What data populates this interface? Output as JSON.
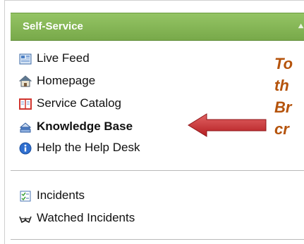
{
  "panel": {
    "title": "Self-Service",
    "collapse_icon": "double-chevron-up-icon",
    "header_color": "#84b556"
  },
  "nav": {
    "group1": [
      {
        "label": "Live Feed",
        "icon": "live-feed-icon"
      },
      {
        "label": "Homepage",
        "icon": "home-icon"
      },
      {
        "label": "Service Catalog",
        "icon": "catalog-book-icon"
      },
      {
        "label": "Knowledge Base",
        "icon": "knowledge-base-icon",
        "active": true
      },
      {
        "label": "Help the Help Desk",
        "icon": "info-icon"
      }
    ],
    "group2": [
      {
        "label": "Incidents",
        "icon": "incidents-checklist-icon"
      },
      {
        "label": "Watched Incidents",
        "icon": "glasses-icon"
      }
    ]
  },
  "callout": {
    "lines": [
      "To",
      "th",
      "Br",
      "cr"
    ],
    "color": "#b5530b",
    "arrow_color": "#c0282b"
  }
}
